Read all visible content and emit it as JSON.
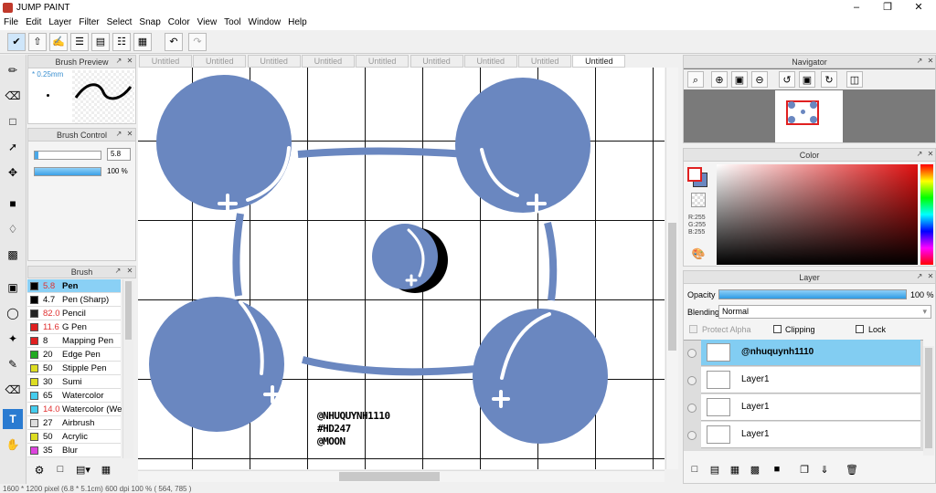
{
  "app": {
    "title": "JUMP PAINT"
  },
  "menubar": {
    "items": [
      "File",
      "Edit",
      "Layer",
      "Filter",
      "Select",
      "Snap",
      "Color",
      "View",
      "Tool",
      "Window",
      "Help"
    ]
  },
  "brush_preview": {
    "title": "Brush Preview",
    "size_label": "* 0.25mm"
  },
  "brush_control": {
    "title": "Brush Control",
    "size_value": "5.8",
    "opacity_value": "100 %",
    "size_fill": 0.05,
    "opacity_fill": 1.0
  },
  "brush_panel": {
    "title": "Brush",
    "items": [
      {
        "size": "5.8",
        "name": "Pen",
        "color": "#000000",
        "size_color": "#e03030",
        "selected": true
      },
      {
        "size": "4.7",
        "name": "Pen (Sharp)",
        "color": "#000000",
        "size_color": "#000000"
      },
      {
        "size": "82.0",
        "name": "Pencil",
        "color": "#222222",
        "size_color": "#e03030"
      },
      {
        "size": "11.6",
        "name": "G Pen",
        "color": "#e02020",
        "size_color": "#e03030"
      },
      {
        "size": "8",
        "name": "Mapping Pen",
        "color": "#e02020",
        "size_color": "#000000"
      },
      {
        "size": "20",
        "name": "Edge Pen",
        "color": "#22aa22",
        "size_color": "#000000"
      },
      {
        "size": "50",
        "name": "Stipple Pen",
        "color": "#dddd22",
        "size_color": "#000000"
      },
      {
        "size": "30",
        "name": "Sumi",
        "color": "#dddd22",
        "size_color": "#000000"
      },
      {
        "size": "65",
        "name": "Watercolor",
        "color": "#44ccee",
        "size_color": "#000000"
      },
      {
        "size": "14.0",
        "name": "Watercolor (We",
        "color": "#44ccee",
        "size_color": "#e03030"
      },
      {
        "size": "27",
        "name": "Airbrush",
        "color": "#dddddd",
        "size_color": "#000000"
      },
      {
        "size": "50",
        "name": "Acrylic",
        "color": "#dddd22",
        "size_color": "#000000"
      },
      {
        "size": "35",
        "name": "Blur",
        "color": "#dd44dd",
        "size_color": "#000000"
      }
    ]
  },
  "tabs": [
    "Untitled",
    "Untitled",
    "Untitled",
    "Untitled",
    "Untitled",
    "Untitled",
    "Untitled",
    "Untitled",
    "Untitled"
  ],
  "artwork": {
    "signature": [
      "@NHUQUYNH1110",
      "#HD247",
      "@MOON"
    ],
    "fill_color": "#6a87c0"
  },
  "navigator": {
    "title": "Navigator"
  },
  "color_panel": {
    "title": "Color",
    "r": "R:255",
    "g": "G:255",
    "b": "B:255"
  },
  "layer_panel": {
    "title": "Layer",
    "opacity_label": "Opacity",
    "opacity_value": "100 %",
    "opacity_fill": 1.0,
    "blending_label": "Blending",
    "blending_value": "Normal",
    "protect_alpha": "Protect Alpha",
    "clipping": "Clipping",
    "lock": "Lock",
    "layers": [
      {
        "name": "@nhuquynh1110",
        "selected": true
      },
      {
        "name": "Layer1"
      },
      {
        "name": "Layer1"
      },
      {
        "name": "Layer1"
      }
    ]
  },
  "status": {
    "text": "1600 * 1200 pixel   (6.8 * 5.1cm)   600 dpi   100 %   ( 564, 785 )"
  }
}
